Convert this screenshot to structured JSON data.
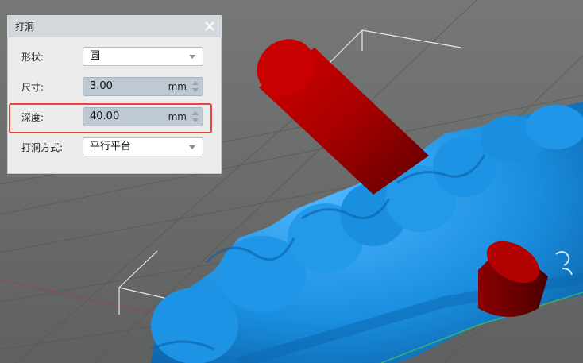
{
  "panel": {
    "title": "打洞",
    "close_icon": "close-icon",
    "fields": {
      "shape": {
        "label": "形状:",
        "value": "圆"
      },
      "size": {
        "label": "尺寸:",
        "value": "3.00",
        "unit": "mm"
      },
      "depth": {
        "label": "深度:",
        "value": "40.00",
        "unit": "mm"
      },
      "method": {
        "label": "打洞方式:",
        "value": "平行平台"
      }
    }
  },
  "colors": {
    "viewport_bg": "#6e6f6f",
    "model_blue": "#1a8fe0",
    "cylinder_red": "#b30000",
    "highlight_red": "#e5473c"
  }
}
